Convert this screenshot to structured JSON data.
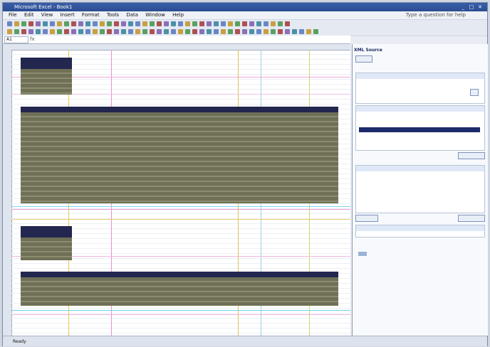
{
  "window": {
    "title": "Microsoft Excel - Book1"
  },
  "menu": {
    "items": [
      "File",
      "Edit",
      "View",
      "Insert",
      "Format",
      "Tools",
      "Data",
      "Window",
      "Help"
    ],
    "help_prompt": "Type a question for help"
  },
  "formula_bar": {
    "name_box": "A1",
    "fx": "fx"
  },
  "task_pane": {
    "title": "XML Source"
  },
  "status": {
    "text": "Ready"
  },
  "colors": {
    "title_bar": "#2b4d91",
    "table_header": "#23264f",
    "table_body": "#7a7a5e",
    "pane_selected": "#1d2a6a"
  }
}
